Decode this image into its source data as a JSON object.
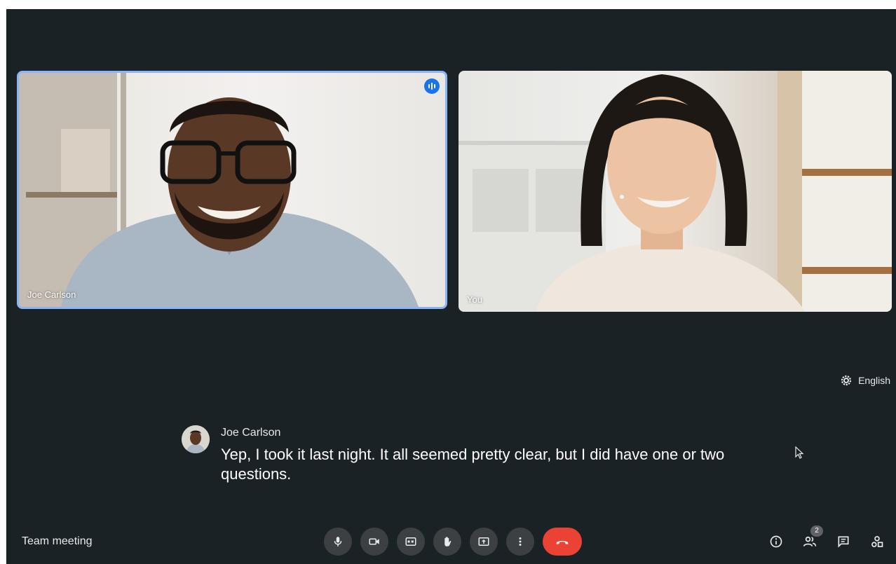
{
  "participants": [
    {
      "name": "Joe Carlson",
      "speaking": true
    },
    {
      "name": "You",
      "speaking": false
    }
  ],
  "captions": {
    "language": "English",
    "speaker": "Joe Carlson",
    "text": "Yep, I took it last night. It all seemed pretty clear, but I did have one or two questions."
  },
  "meeting": {
    "name": "Team meeting"
  },
  "controls": {
    "mic": "mic-icon",
    "camera": "camera-icon",
    "captions": "closed-captions-icon",
    "raise_hand": "raise-hand-icon",
    "present": "present-screen-icon",
    "more": "more-options-icon",
    "end_call": "end-call-icon"
  },
  "people_count": "2",
  "colors": {
    "background": "#1b2225",
    "active_speaker_border": "#8ab4f8",
    "end_call": "#ea4335",
    "control_button": "#3c4043"
  }
}
